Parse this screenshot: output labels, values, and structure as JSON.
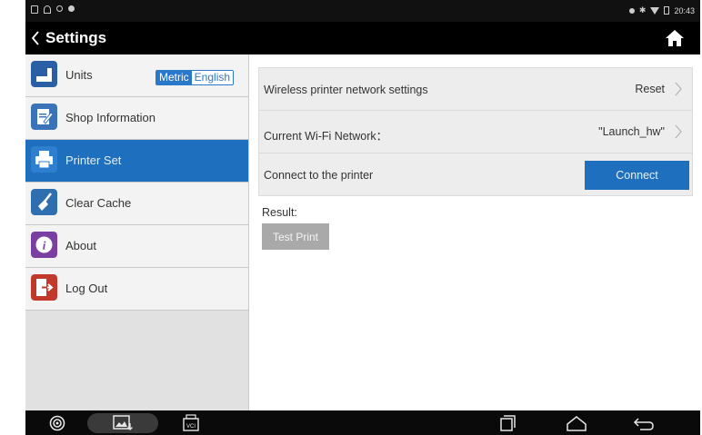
{
  "status_bar": {
    "time": "20:43",
    "left_icons": [
      "notification-icon",
      "usb-icon",
      "settings-notify-icon",
      "location-icon"
    ],
    "right_icons": [
      "location-icon",
      "bluetooth-icon",
      "wifi-icon",
      "battery-icon"
    ]
  },
  "header": {
    "title": "Settings",
    "back_icon": "chevron-left-icon",
    "home_icon": "home-icon"
  },
  "sidebar": {
    "items": [
      {
        "label": "Units",
        "icon": "units-icon",
        "icon_color": "#2a5fa6"
      },
      {
        "label": "Shop Information",
        "icon": "shop-info-icon",
        "icon_color": "#3b73b9"
      },
      {
        "label": "Printer Set",
        "icon": "printer-icon",
        "icon_color": "#2f7fd0",
        "active": true
      },
      {
        "label": "Clear Cache",
        "icon": "broom-icon",
        "icon_color": "#2f6fb0"
      },
      {
        "label": "About",
        "icon": "info-icon",
        "icon_color": "#7a3fa0"
      },
      {
        "label": "Log Out",
        "icon": "logout-icon",
        "icon_color": "#c0392b"
      }
    ],
    "units_toggle": {
      "metric": "Metric",
      "english": "English",
      "selected": "English"
    }
  },
  "printer": {
    "rows": [
      {
        "label": "Wireless printer network settings",
        "value": "Reset"
      },
      {
        "label": "Current Wi-Fi Network：",
        "value": "\"Launch_hw\""
      },
      {
        "label": "Connect to the printer",
        "button": "Connect"
      }
    ],
    "result_label": "Result:",
    "test_print": "Test Print"
  },
  "nav_bar": {
    "icons": [
      "launcher-icon",
      "gallery-icon",
      "vci-icon",
      "recent-apps-icon",
      "home-nav-icon",
      "back-nav-icon"
    ],
    "vci_text": "VCI"
  },
  "colors": {
    "accent": "#1f6fbf",
    "active_item_bg": "#1f6fbf",
    "disabled_button": "#a9a9a9"
  }
}
